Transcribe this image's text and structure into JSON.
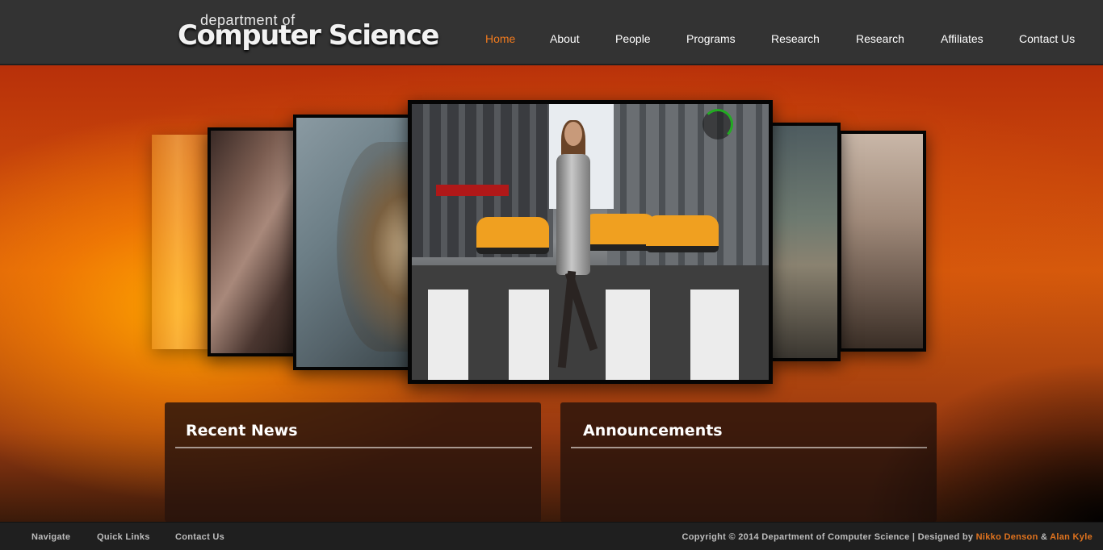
{
  "logo": {
    "small": "department of",
    "big": "Computer Science"
  },
  "nav": {
    "items": [
      {
        "label": "Home",
        "active": true
      },
      {
        "label": "About"
      },
      {
        "label": "People"
      },
      {
        "label": "Programs"
      },
      {
        "label": "Research"
      },
      {
        "label": "Research"
      },
      {
        "label": "Affiliates"
      },
      {
        "label": "Contact Us"
      }
    ]
  },
  "panels": {
    "news": {
      "title": "Recent News"
    },
    "announcements": {
      "title": "Announcements"
    }
  },
  "footer": {
    "links": [
      "Navigate",
      "Quick Links",
      "Contact Us"
    ],
    "copyright_prefix": "Copyright © 2014 Department of Computer Science | Designed by ",
    "designer_1": "Nikko Denson",
    "amp": " & ",
    "designer_2": "Alan Kyle"
  },
  "colors": {
    "accent": "#f07a1e",
    "header_bg": "#333333",
    "footer_bg": "#1f1f1f"
  }
}
